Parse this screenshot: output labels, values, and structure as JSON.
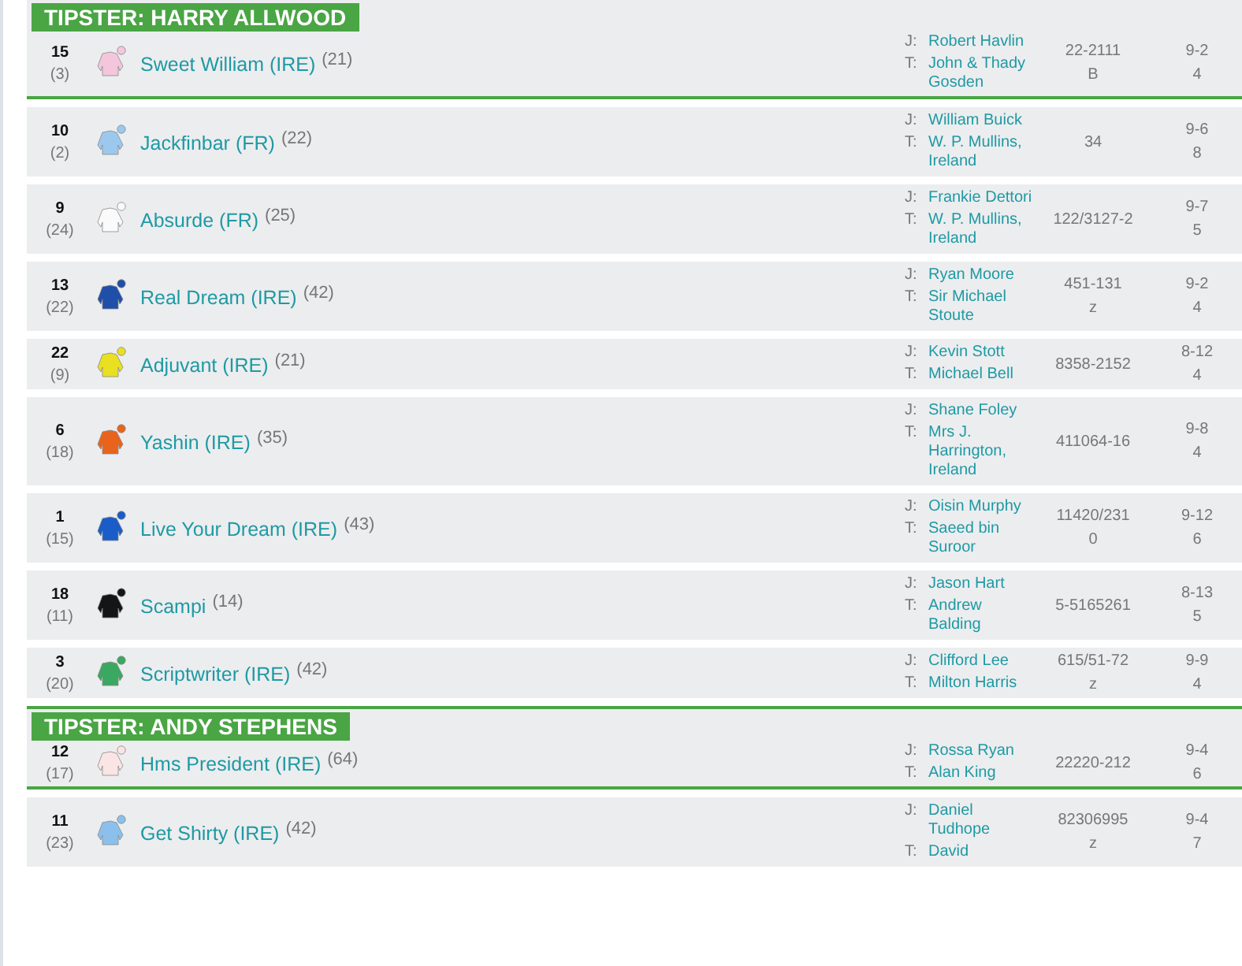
{
  "groups": [
    {
      "tipster": "TIPSTER: HARRY ALLWOOD",
      "runners": [
        {
          "number": "15",
          "draw": "(3)",
          "name": "Sweet William (IRE)",
          "rating": "(21)",
          "color": "#f4c6dc",
          "jockey_label": "J:",
          "jockey": "Robert Havlin",
          "trainer_label": "T:",
          "trainer": "John & Thady Gosden",
          "form": "22-2111",
          "form_extra": "B",
          "weight": "9-2",
          "age": "4"
        },
        {
          "number": "10",
          "draw": "(2)",
          "name": "Jackfinbar (FR)",
          "rating": "(22)",
          "color": "#9cc8ee",
          "jockey_label": "J:",
          "jockey": "William Buick",
          "trainer_label": "T:",
          "trainer": "W. P. Mullins, Ireland",
          "form": "34",
          "weight": "9-6",
          "age": "8"
        },
        {
          "number": "9",
          "draw": "(24)",
          "name": "Absurde (FR)",
          "rating": "(25)",
          "color": "#fafafa",
          "jockey_label": "J:",
          "jockey": "Frankie Dettori",
          "trainer_label": "T:",
          "trainer": "W. P. Mullins, Ireland",
          "form": "122/3127-2",
          "weight": "9-7",
          "age": "5"
        },
        {
          "number": "13",
          "draw": "(22)",
          "name": "Real Dream (IRE)",
          "rating": "(42)",
          "color": "#1f4fa8",
          "jockey_label": "J:",
          "jockey": "Ryan Moore",
          "trainer_label": "T:",
          "trainer": "Sir Michael Stoute",
          "form": "451-131",
          "form_extra": "z",
          "weight": "9-2",
          "age": "4"
        },
        {
          "number": "22",
          "draw": "(9)",
          "name": "Adjuvant (IRE)",
          "rating": "(21)",
          "color": "#e8e020",
          "jockey_label": "J:",
          "jockey": "Kevin Stott",
          "trainer_label": "T:",
          "trainer": "Michael Bell",
          "form": "8358-2152",
          "weight": "8-12",
          "age": "4"
        },
        {
          "number": "6",
          "draw": "(18)",
          "name": "Yashin (IRE)",
          "rating": "(35)",
          "color": "#e8641c",
          "jockey_label": "J:",
          "jockey": "Shane Foley",
          "trainer_label": "T:",
          "trainer": "Mrs J. Harrington, Ireland",
          "form": "411064-16",
          "weight": "9-8",
          "age": "4"
        },
        {
          "number": "1",
          "draw": "(15)",
          "name": "Live Your Dream (IRE)",
          "rating": "(43)",
          "color": "#1a5cc8",
          "jockey_label": "J:",
          "jockey": "Oisin Murphy",
          "trainer_label": "T:",
          "trainer": "Saeed bin Suroor",
          "form": "11420/231",
          "form_extra": "0",
          "weight": "9-12",
          "age": "6"
        },
        {
          "number": "18",
          "draw": "(11)",
          "name": "Scampi",
          "rating": "(14)",
          "color": "#151515",
          "jockey_label": "J:",
          "jockey": "Jason Hart",
          "trainer_label": "T:",
          "trainer": "Andrew Balding",
          "form": "5-5165261",
          "weight": "8-13",
          "age": "5"
        },
        {
          "number": "3",
          "draw": "(20)",
          "name": "Scriptwriter (IRE)",
          "rating": "(42)",
          "color": "#3aa860",
          "jockey_label": "J:",
          "jockey": "Clifford Lee",
          "trainer_label": "T:",
          "trainer": "Milton Harris",
          "form": "615/51-72",
          "form_extra": "z",
          "weight": "9-9",
          "age": "4"
        }
      ]
    },
    {
      "tipster": "TIPSTER: ANDY STEPHENS",
      "runners": [
        {
          "number": "12",
          "draw": "(17)",
          "name": "Hms President (IRE)",
          "rating": "(64)",
          "color": "#fbe4e4",
          "jockey_label": "J:",
          "jockey": "Rossa Ryan",
          "trainer_label": "T:",
          "trainer": "Alan King",
          "form": "22220-212",
          "weight": "9-4",
          "age": "6"
        },
        {
          "number": "11",
          "draw": "(23)",
          "name": "Get Shirty (IRE)",
          "rating": "(42)",
          "color": "#8cc0ec",
          "jockey_label": "J:",
          "jockey": "Daniel Tudhope",
          "trainer_label": "T:",
          "trainer": "David",
          "form": "82306995",
          "form_extra": "z",
          "weight": "9-4",
          "age": "7"
        }
      ]
    }
  ]
}
